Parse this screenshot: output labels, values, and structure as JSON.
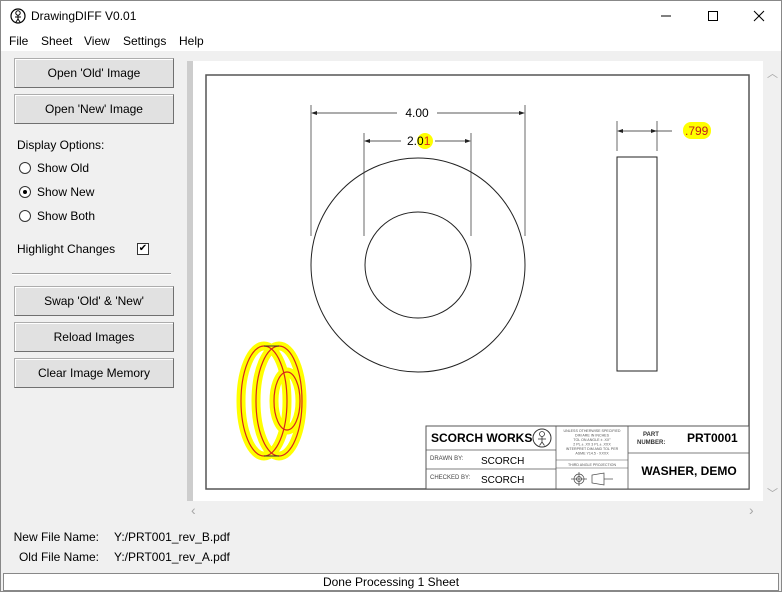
{
  "window": {
    "title": "DrawingDIFF V0.01",
    "minimize_icon": "minimize-icon",
    "maximize_icon": "maximize-icon",
    "close_icon": "close-icon"
  },
  "menu": {
    "items": [
      "File",
      "Sheet",
      "View",
      "Settings",
      "Help"
    ]
  },
  "sidebar": {
    "open_old_label": "Open 'Old' Image",
    "open_new_label": "Open 'New' Image",
    "display_options_label": "Display Options:",
    "radios": [
      {
        "label": "Show Old",
        "checked": false
      },
      {
        "label": "Show New",
        "checked": true
      },
      {
        "label": "Show Both",
        "checked": false
      }
    ],
    "highlight_changes_label": "Highlight Changes",
    "highlight_changes_checked": true,
    "check_glyph": "✔",
    "swap_label": "Swap 'Old' & 'New'",
    "reload_label": "Reload Images",
    "clear_memory_label": "Clear Image Memory"
  },
  "drawing": {
    "dim_outer": "4.00",
    "dim_inner_prefix": "2.0",
    "dim_inner_changed": "1",
    "dim_thickness": ".799",
    "highlight_color": "#ffff00",
    "change_color": "#e0201a",
    "title_block": {
      "company": "SCORCH WORKS",
      "drawn_by_label": "DRAWN BY:",
      "drawn_by": "SCORCH",
      "checked_by_label": "CHECKED BY:",
      "checked_by": "SCORCH",
      "tolerance_lines": [
        "UNLESS OTHERWISE SPECIFIED",
        "DIM ARE IN INCHES",
        "TOL ON ANGLE  ± .XX°",
        "2 PL  ± .XX 3 PL  ± .XXX",
        "INTERPRET DIM AND TOL PER",
        "ASME Y14.5 - XXXX"
      ],
      "projection_label": "THIRD ANGLE PROJECTION",
      "part_number_label_1": "PART",
      "part_number_label_2": "NUMBER:",
      "part_number": "PRT0001",
      "part_name": "WASHER, DEMO"
    }
  },
  "scroll": {
    "up": "︿",
    "down": "﹀",
    "left": "‹",
    "right": "›"
  },
  "files": {
    "new_label": "New File Name:",
    "new_value": "Y:/PRT001_rev_B.pdf",
    "old_label": "Old File Name:",
    "old_value": "Y:/PRT001_rev_A.pdf"
  },
  "status": {
    "text": "Done Processing 1 Sheet"
  }
}
